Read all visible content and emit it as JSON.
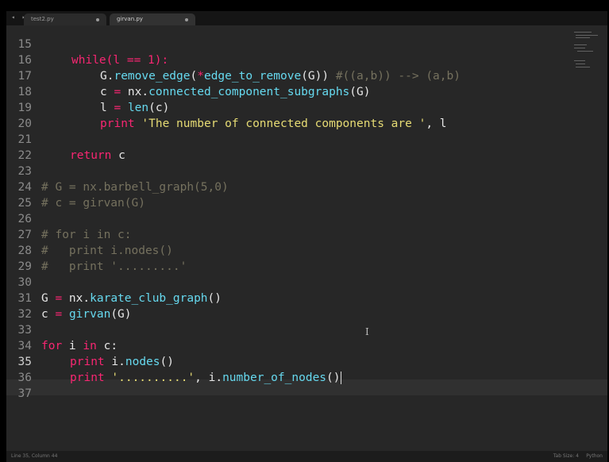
{
  "tabs": [
    {
      "label": "test2.py"
    },
    {
      "label": "girvan.py"
    }
  ],
  "nav_arrows": "◂ ▸",
  "lines": [
    {
      "n": "15"
    },
    {
      "n": "16"
    },
    {
      "n": "17"
    },
    {
      "n": "18"
    },
    {
      "n": "19"
    },
    {
      "n": "20"
    },
    {
      "n": "21"
    },
    {
      "n": "22"
    },
    {
      "n": "23"
    },
    {
      "n": "24"
    },
    {
      "n": "25"
    },
    {
      "n": "26"
    },
    {
      "n": "27"
    },
    {
      "n": "28"
    },
    {
      "n": "29"
    },
    {
      "n": "30"
    },
    {
      "n": "31"
    },
    {
      "n": "32"
    },
    {
      "n": "33"
    },
    {
      "n": "34"
    },
    {
      "n": "35"
    },
    {
      "n": "36"
    },
    {
      "n": "37"
    }
  ],
  "code": {
    "l15": "while(l == 1):",
    "l16_a": "G.",
    "l16_b": "remove_edge",
    "l16_c": "(",
    "l16_d": "*",
    "l16_e": "edge_to_remove",
    "l16_f": "(G)) ",
    "l16_g": "#((a,b)) --> (a,b)",
    "l17_a": "c ",
    "l17_b": "=",
    "l17_c": " nx.",
    "l17_d": "connected_component_subgraphs",
    "l17_e": "(G)",
    "l18_a": "l ",
    "l18_b": "=",
    "l18_c": " ",
    "l18_d": "len",
    "l18_e": "(c)",
    "l19_a": "print",
    "l19_b": " ",
    "l19_c": "'The number of connected components are '",
    "l19_d": ", l",
    "l21_a": "return",
    "l21_b": " c",
    "l23": "# G = nx.barbell_graph(5,0)",
    "l24": "# c = girvan(G)",
    "l26": "# for i in c:",
    "l27": "#   print i.nodes()",
    "l28": "#   print '.........'",
    "l30_a": "G ",
    "l30_b": "=",
    "l30_c": " nx.",
    "l30_d": "karate_club_graph",
    "l30_e": "()",
    "l31_a": "c ",
    "l31_b": "=",
    "l31_c": " ",
    "l31_d": "girvan",
    "l31_e": "(G)",
    "l33_a": "for",
    "l33_b": " i ",
    "l33_c": "in",
    "l33_d": " c:",
    "l34_a": "print",
    "l34_b": " i.",
    "l34_c": "nodes",
    "l34_d": "()",
    "l35_a": "print",
    "l35_b": " ",
    "l35_c": "'..........'",
    "l35_d": ", i.",
    "l35_e": "number_of_nodes",
    "l35_f": "()"
  },
  "status": {
    "left": "Line 35, Column 44",
    "tab_size": "Tab Size: 4",
    "syntax": "Python"
  }
}
